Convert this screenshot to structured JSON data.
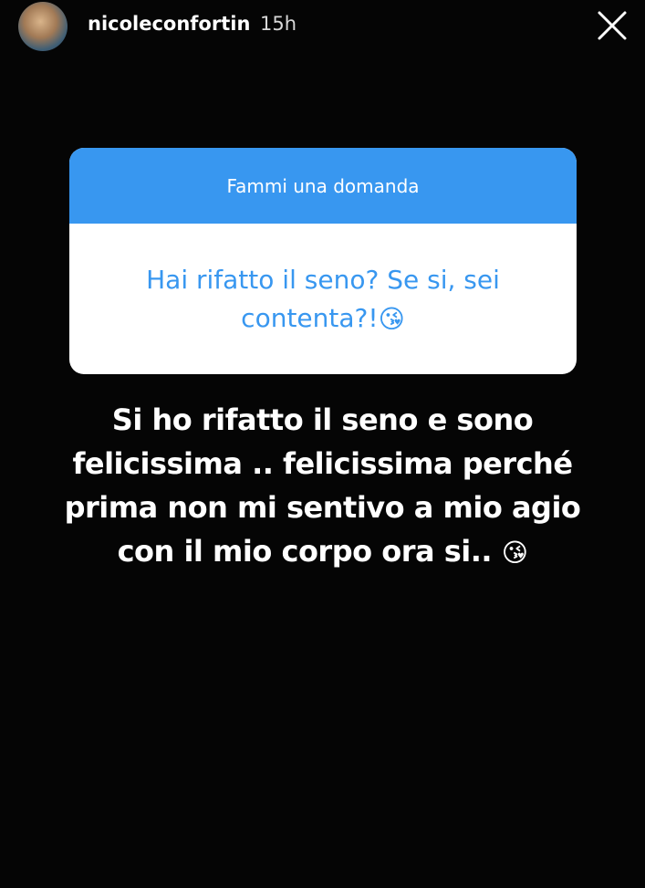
{
  "header": {
    "username": "nicoleconfortin",
    "time": "15h",
    "close_icon": "close-icon"
  },
  "question_sticker": {
    "title": "Fammi una domanda",
    "question": "Hai rifatto il seno? Se si, sei contenta?!",
    "question_emoji": "😘",
    "header_color": "#3897f0",
    "text_color": "#3897f0"
  },
  "answer": {
    "text": "Si ho rifatto il seno e sono felicissima .. felicissima perché prima non mi sentivo a mio agio con il mio corpo ora si..",
    "emoji": "😘"
  }
}
